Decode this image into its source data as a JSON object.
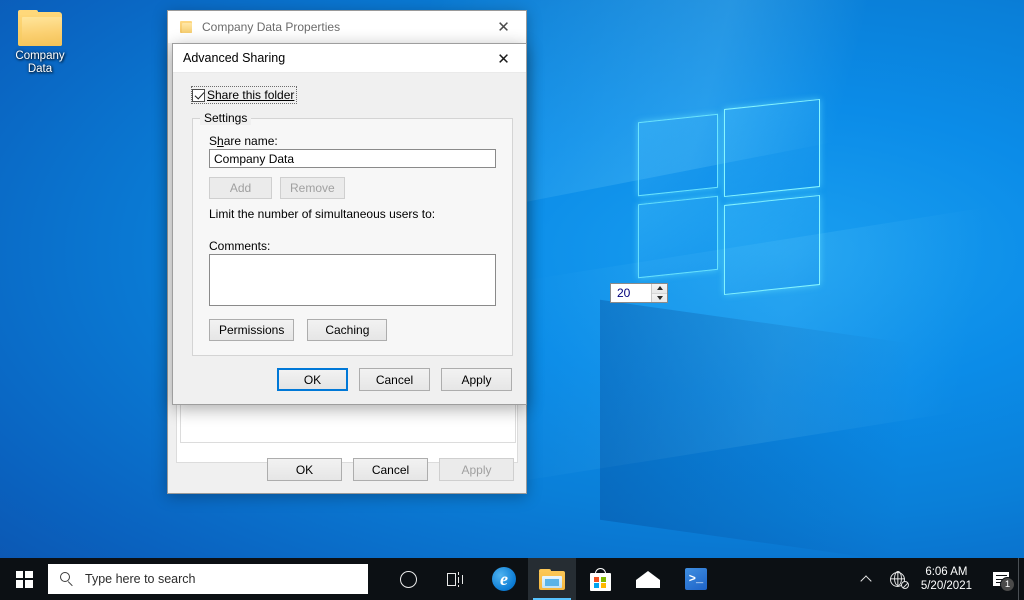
{
  "desktop": {
    "icon": {
      "name": "folder-icon",
      "label_line1": "Company",
      "label_line2": "Data"
    }
  },
  "properties_window": {
    "title": "Company Data Properties",
    "icon": "folder-icon",
    "close_label": "✕",
    "buttons": {
      "ok": "OK",
      "cancel": "Cancel",
      "apply": "Apply"
    }
  },
  "advanced_sharing": {
    "title": "Advanced Sharing",
    "close_label": "✕",
    "share_checkbox": {
      "label": "Share this folder",
      "checked": true
    },
    "settings_group": {
      "legend": "Settings",
      "share_name_label": "Share name:",
      "share_name_value": "Company Data",
      "share_name_placeholder": "",
      "add_button": "Add",
      "remove_button": "Remove",
      "limit_label": "Limit the number of simultaneous users to:",
      "limit_value": "20",
      "comments_label": "Comments:",
      "comments_value": "",
      "comments_placeholder": "",
      "permissions_button": "Permissions",
      "caching_button": "Caching"
    },
    "buttons": {
      "ok": "OK",
      "cancel": "Cancel",
      "apply": "Apply"
    },
    "accent_color": "#0078d7"
  },
  "taskbar": {
    "start": "start-button",
    "search": {
      "placeholder": "Type here to search",
      "icon": "search-icon"
    },
    "items": [
      {
        "name": "cortana-icon",
        "label": "Cortana"
      },
      {
        "name": "task-view-icon",
        "label": "Task View"
      },
      {
        "name": "microsoft-edge-icon",
        "label": "Microsoft Edge"
      },
      {
        "name": "file-explorer-icon",
        "label": "File Explorer"
      },
      {
        "name": "microsoft-store-icon",
        "label": "Microsoft Store"
      },
      {
        "name": "mail-icon",
        "label": "Mail"
      },
      {
        "name": "powershell-icon",
        "label": "Windows PowerShell"
      }
    ],
    "tray": {
      "chevron": "show-hidden-icons",
      "network_icon": "network-no-internet-icon",
      "time": "6:06 AM",
      "date": "5/20/2021",
      "notifications_icon": "action-center-icon",
      "notifications_count": "1"
    }
  }
}
